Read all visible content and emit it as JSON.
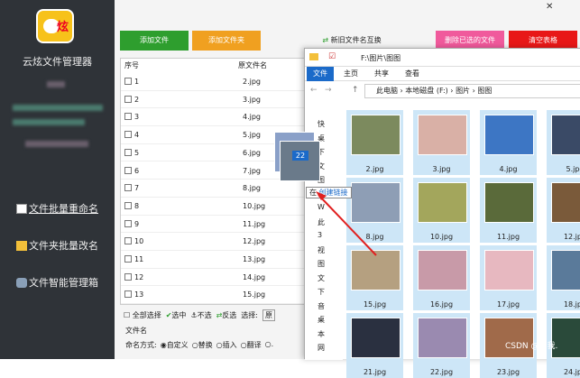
{
  "app": {
    "title": "云炫文件管理器",
    "logo_text": "炫"
  },
  "sidebar": {
    "items": [
      {
        "label": "文件批量重命名",
        "active": true
      },
      {
        "label": "文件夹批量改名"
      },
      {
        "label": "文件智能管理箱"
      }
    ]
  },
  "buttons": {
    "add_file": "添加文件",
    "add_folder": "添加文件夹",
    "swap": "新旧文件名互换",
    "delete_selected": "删除已选的文件",
    "clear": "清空表格"
  },
  "table": {
    "headers": {
      "no": "序号",
      "name": "原文件名"
    },
    "rows": [
      {
        "no": "1",
        "name": "2.jpg"
      },
      {
        "no": "2",
        "name": "3.jpg"
      },
      {
        "no": "3",
        "name": "4.jpg"
      },
      {
        "no": "4",
        "name": "5.jpg"
      },
      {
        "no": "5",
        "name": "6.jpg"
      },
      {
        "no": "6",
        "name": "7.jpg"
      },
      {
        "no": "7",
        "name": "8.jpg"
      },
      {
        "no": "8",
        "name": "10.jpg"
      },
      {
        "no": "9",
        "name": "11.jpg"
      },
      {
        "no": "10",
        "name": "12.jpg"
      },
      {
        "no": "11",
        "name": "13.jpg"
      },
      {
        "no": "12",
        "name": "14.jpg"
      },
      {
        "no": "13",
        "name": "15.jpg"
      }
    ]
  },
  "footer": {
    "select_all": "全部选择",
    "select": "选中",
    "deselect": "不选",
    "invert": "反选",
    "choose": "选择:",
    "choose_value": "原",
    "section": "文件名",
    "naming": "命名方式:",
    "opts": [
      "自定义",
      "替换",
      "插入",
      "翻译",
      "."
    ]
  },
  "explorer": {
    "title": "F:\\图片\\图图",
    "tabs": [
      "文件",
      "主页",
      "共享",
      "查看"
    ],
    "breadcrumb": [
      "此电脑",
      "本地磁盘 (F:)",
      "图片",
      "图图"
    ],
    "nav": [
      "快",
      "桌",
      "下",
      "文",
      "图",
      "图",
      "W",
      "此",
      "3",
      "视",
      "图",
      "文",
      "下",
      "音",
      "桌",
      "本",
      "网"
    ]
  },
  "thumbs": [
    {
      "name": "2.jpg",
      "color": "#7c8a5e"
    },
    {
      "name": "3.jpg",
      "color": "#d9b0a6"
    },
    {
      "name": "4.jpg",
      "color": "#3d76c4"
    },
    {
      "name": "5.jpg",
      "color": "#3a4a66"
    },
    {
      "name": "8.jpg",
      "color": "#8e9eb5"
    },
    {
      "name": "10.jpg",
      "color": "#a3a65c"
    },
    {
      "name": "11.jpg",
      "color": "#5a6a3a"
    },
    {
      "name": "12.jpg",
      "color": "#7a5a3a"
    },
    {
      "name": "15.jpg",
      "color": "#b5a080"
    },
    {
      "name": "16.jpg",
      "color": "#c89aa8"
    },
    {
      "name": "17.jpg",
      "color": "#e7b8c0"
    },
    {
      "name": "18.jpg",
      "color": "#5a7a9a"
    },
    {
      "name": "21.jpg",
      "color": "#2a3040"
    },
    {
      "name": "22.jpg",
      "color": "#9a8ab0"
    },
    {
      "name": "23.jpg",
      "color": "#a06a4a"
    },
    {
      "name": "24.jpg",
      "color": "#2a4a3a"
    }
  ],
  "drag": {
    "count": "22",
    "tip_prefix": "在",
    "tip_action": "创建链接"
  },
  "watermark": "CSDN @叫我."
}
